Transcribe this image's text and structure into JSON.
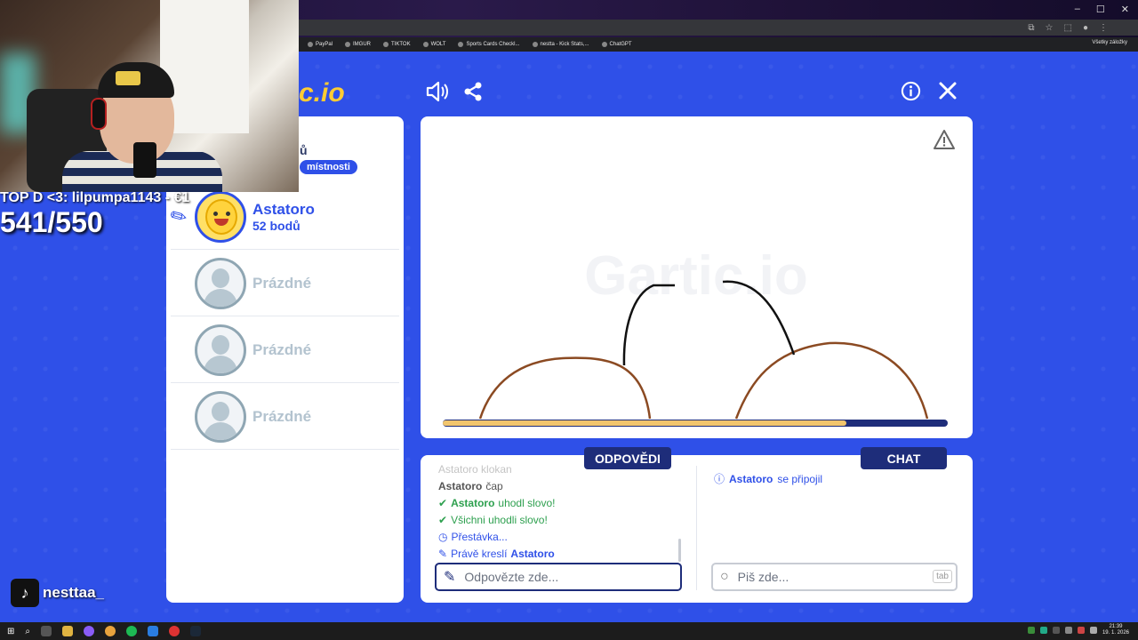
{
  "browser": {
    "bookmarks": [
      "PayPal",
      "IMGUR",
      "TIKTOK",
      "WOLT",
      "Sports Cards Checkl...",
      "nestta - Kick Stats,...",
      "ChatGPT"
    ],
    "bookmarks_right": "Všetky záložky"
  },
  "game": {
    "logo_visible": "c.io",
    "players_header_partial": "ů",
    "room_label": "místnosti",
    "players": [
      {
        "name": "Astatoro",
        "score": "52 bodů",
        "active": true
      },
      {
        "name": "Prázdné",
        "active": false
      },
      {
        "name": "Prázdné",
        "active": false
      },
      {
        "name": "Prázdné",
        "active": false
      }
    ],
    "answers_tab": "ODPOVĚDI",
    "chat_tab": "CHAT",
    "answers": {
      "faded_message": "Astatoro klokan",
      "messages": [
        {
          "user": "Astatoro",
          "text": "čap",
          "type": "plain"
        },
        {
          "user": "Astatoro",
          "text": "uhodl slovo!",
          "type": "green"
        },
        {
          "user": "",
          "text": "Všichni uhodli slovo!",
          "type": "green"
        },
        {
          "user": "",
          "text": "Přestávka...",
          "type": "blue"
        },
        {
          "user": "Astatoro",
          "text": "Právě kreslí",
          "type": "blue-pre"
        }
      ],
      "input_placeholder": "Odpovězte zde..."
    },
    "chat": {
      "message_user": "Astatoro",
      "message_text": "se připojil",
      "input_placeholder": "Piš zde...",
      "tab_key": "tab"
    },
    "timer_progress": 0.8
  },
  "stream": {
    "top_donor": "TOP D <3: lilpumpa1143 - €1",
    "counter": "541/550",
    "tiktok_handle": "nesttaa_"
  },
  "taskbar": {
    "time": "21:39",
    "date": "19. 1. 2026"
  },
  "colors": {
    "accent": "#2f50e8",
    "dark_blue": "#1e2d7a",
    "green": "#2ea04f"
  }
}
